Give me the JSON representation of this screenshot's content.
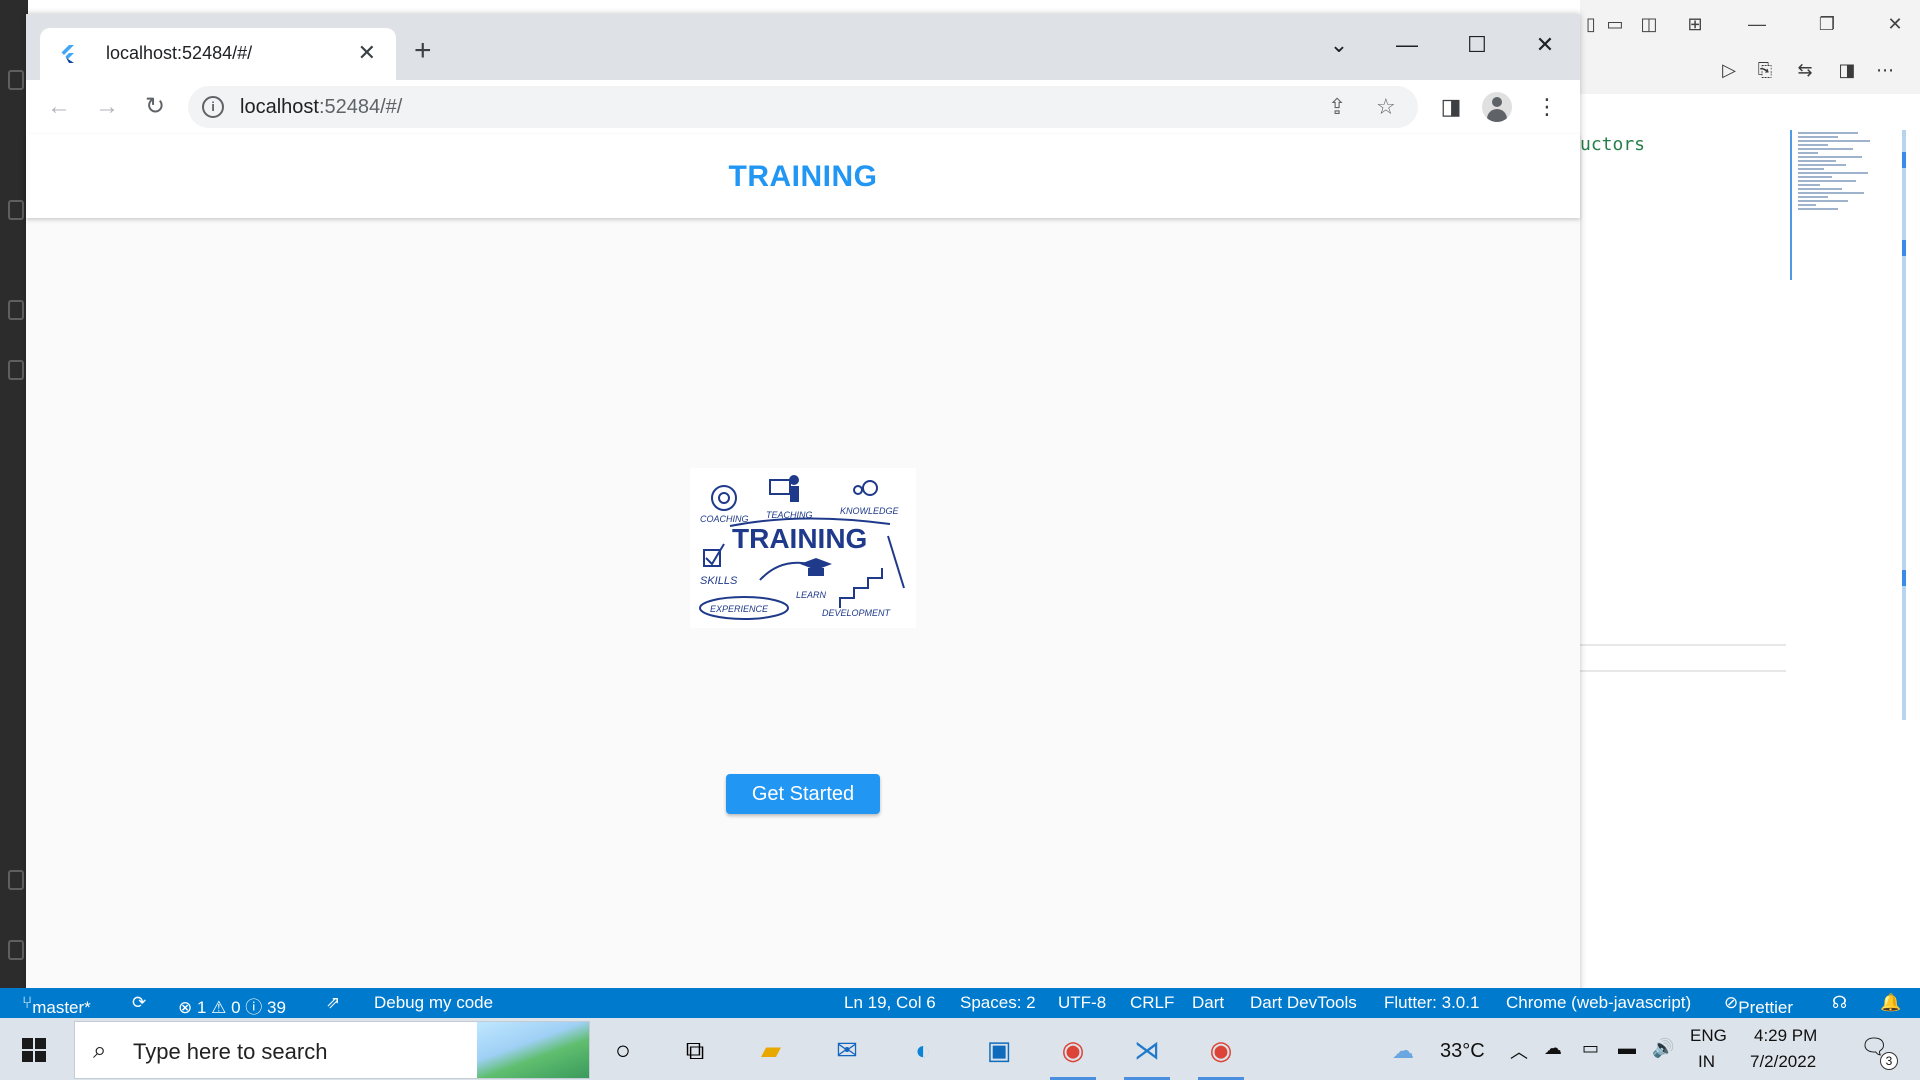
{
  "browser": {
    "tab_title": "localhost:52484/#/",
    "url_host": "localhost",
    "url_rest": ":52484/#/"
  },
  "page": {
    "appbar_title": "TRAINING",
    "button_label": "Get Started",
    "hero_image": {
      "title": "TRAINING",
      "words": [
        "COACHING",
        "TEACHING",
        "KNOWLEDGE",
        "SKILLS",
        "EXPERIENCE",
        "LEARN",
        "DEVELOPMENT"
      ]
    }
  },
  "vscode": {
    "code_fragment": "uctors",
    "statusbar": {
      "branch": "master*",
      "problems": "⊗ 1 ⚠ 0 ⓘ 39",
      "debug": "Debug my code",
      "position": "Ln 19, Col 6",
      "spaces": "Spaces: 2",
      "encoding": "UTF-8",
      "eol": "CRLF",
      "language": "Dart",
      "devtools": "Dart DevTools",
      "flutter": "Flutter: 3.0.1",
      "device": "Chrome (web-javascript)",
      "prettier": "Prettier"
    }
  },
  "taskbar": {
    "search_placeholder": "Type here to search",
    "weather": "33°C",
    "lang_top": "ENG",
    "lang_bottom": "IN",
    "time": "4:29 PM",
    "date": "7/2/2022",
    "notifications": "3"
  },
  "colors": {
    "primary": "#2196f3",
    "statusbar": "#007acc",
    "taskbar": "#dde3ea",
    "hero_ink": "#1f3a8a"
  }
}
